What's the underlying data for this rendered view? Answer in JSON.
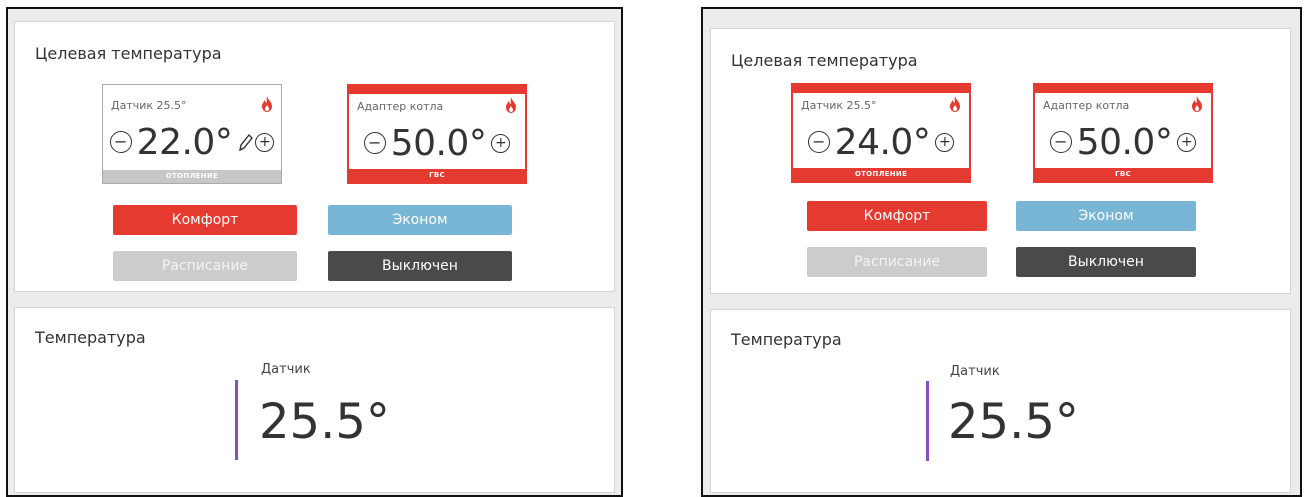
{
  "colors": {
    "accent_red": "#e43a2f",
    "econom_blue": "#79b6d6",
    "off_dark": "#4a4a4a",
    "schedule_gray": "#cccccc",
    "sensor_purple": "#8a4fbf"
  },
  "left": {
    "target": {
      "title": "Целевая температура",
      "tiles": [
        {
          "label": "Датчик 25.5°",
          "value": "22.0°",
          "footer": "ОТОПЛЕНИЕ",
          "active": false,
          "icons": [
            "minus-circle-icon",
            "edit-pencil-icon",
            "plus-circle-icon",
            "flame-icon"
          ]
        },
        {
          "label": "Адаптер котла",
          "value": "50.0°",
          "footer": "ГВС",
          "active": true,
          "icons": [
            "minus-circle-icon",
            "plus-circle-icon",
            "flame-icon"
          ]
        }
      ],
      "modes": {
        "comfort": "Комфорт",
        "econom": "Эконом",
        "schedule": "Расписание",
        "off": "Выключен"
      }
    },
    "temperature": {
      "title": "Температура",
      "sensor_label": "Датчик",
      "sensor_value": "25.5°"
    }
  },
  "right": {
    "target": {
      "title": "Целевая температура",
      "tiles": [
        {
          "label": "Датчик 25.5°",
          "value": "24.0°",
          "footer": "ОТОПЛЕНИЕ",
          "active": true,
          "icons": [
            "minus-circle-icon",
            "plus-circle-icon",
            "flame-icon"
          ]
        },
        {
          "label": "Адаптер котла",
          "value": "50.0°",
          "footer": "ГВС",
          "active": true,
          "icons": [
            "minus-circle-icon",
            "plus-circle-icon",
            "flame-icon"
          ]
        }
      ],
      "modes": {
        "comfort": "Комфорт",
        "econom": "Эконом",
        "schedule": "Расписание",
        "off": "Выключен"
      }
    },
    "temperature": {
      "title": "Температура",
      "sensor_label": "Датчик",
      "sensor_value": "25.5°"
    }
  }
}
